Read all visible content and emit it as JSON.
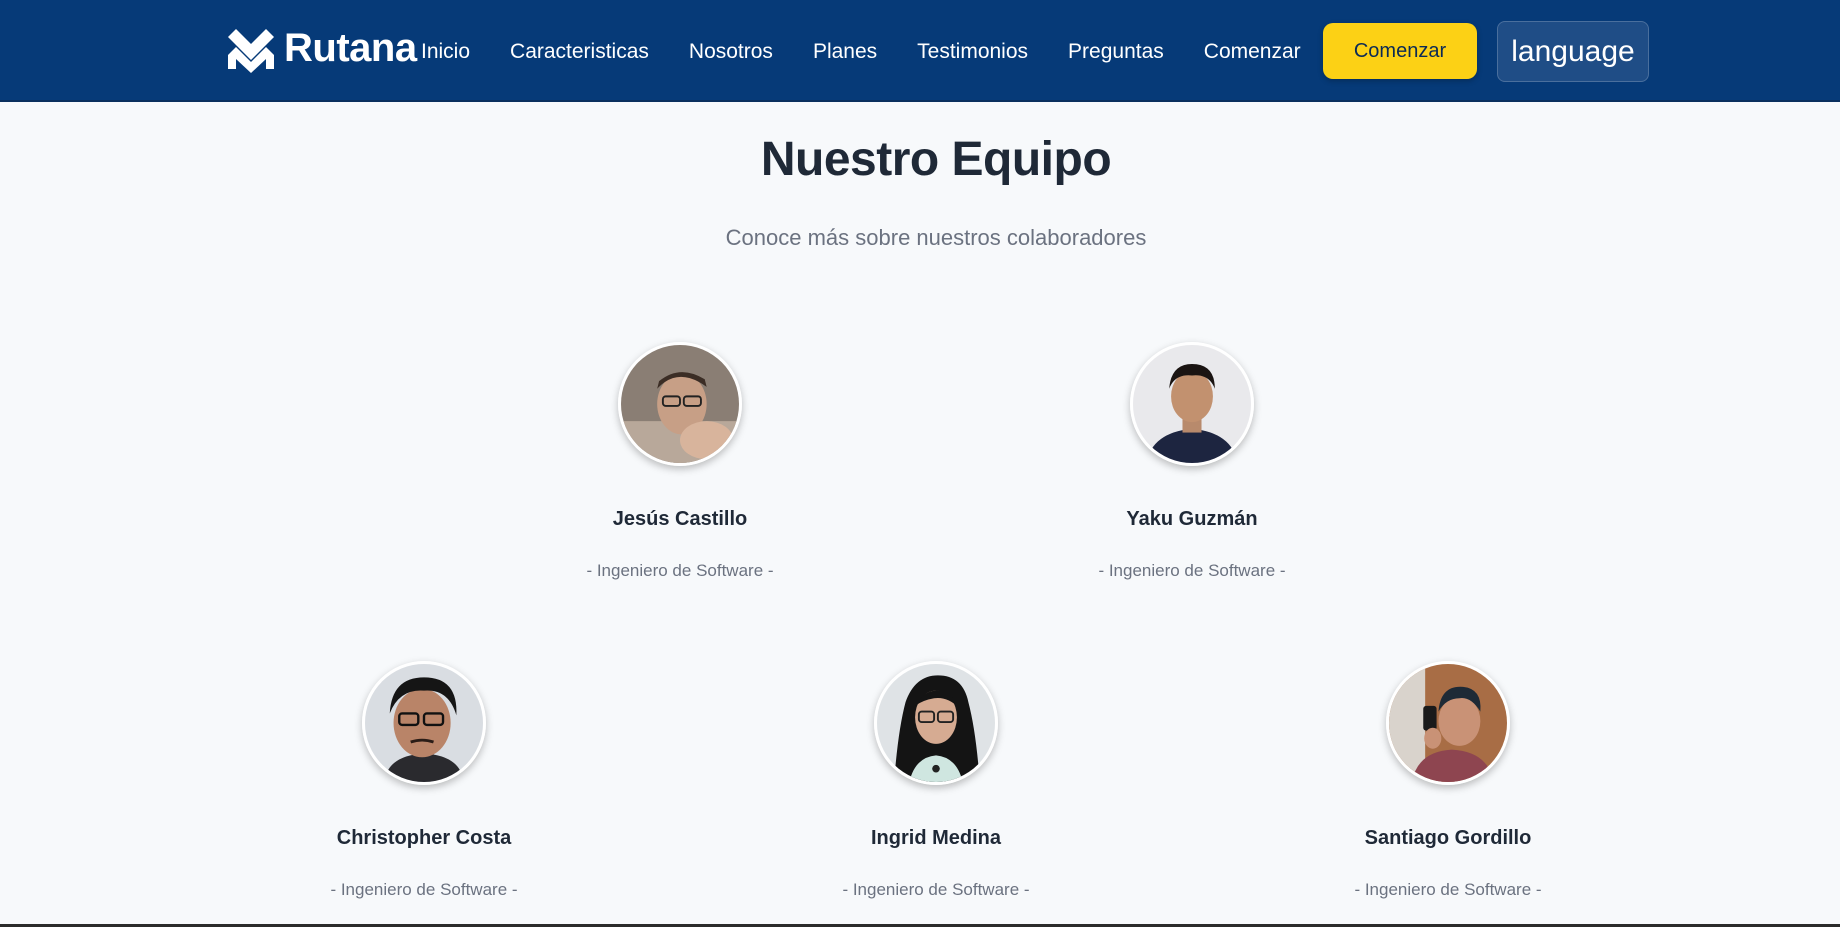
{
  "navbar": {
    "brand": "Rutana",
    "links": [
      "Inicio",
      "Caracteristicas",
      "Nosotros",
      "Planes",
      "Testimonios",
      "Preguntas",
      "Comenzar"
    ],
    "start_button": "Comenzar",
    "language_button": "language"
  },
  "team": {
    "title": "Nuestro Equipo",
    "subtitle": "Conoce más sobre nuestros colaboradores",
    "members": [
      {
        "name": "Jesús Castillo",
        "role": "- Ingeniero de Software -"
      },
      {
        "name": "Yaku Guzmán",
        "role": "- Ingeniero de Software -"
      },
      {
        "name": "Christopher Costa",
        "role": "- Ingeniero de Software -"
      },
      {
        "name": "Ingrid Medina",
        "role": "- Ingeniero de Software -"
      },
      {
        "name": "Santiago Gordillo",
        "role": "- Ingeniero de Software -"
      }
    ]
  },
  "colors": {
    "navbar_bg": "#063a78",
    "accent_button": "#fcd115",
    "page_bg": "#f7f9fb"
  }
}
